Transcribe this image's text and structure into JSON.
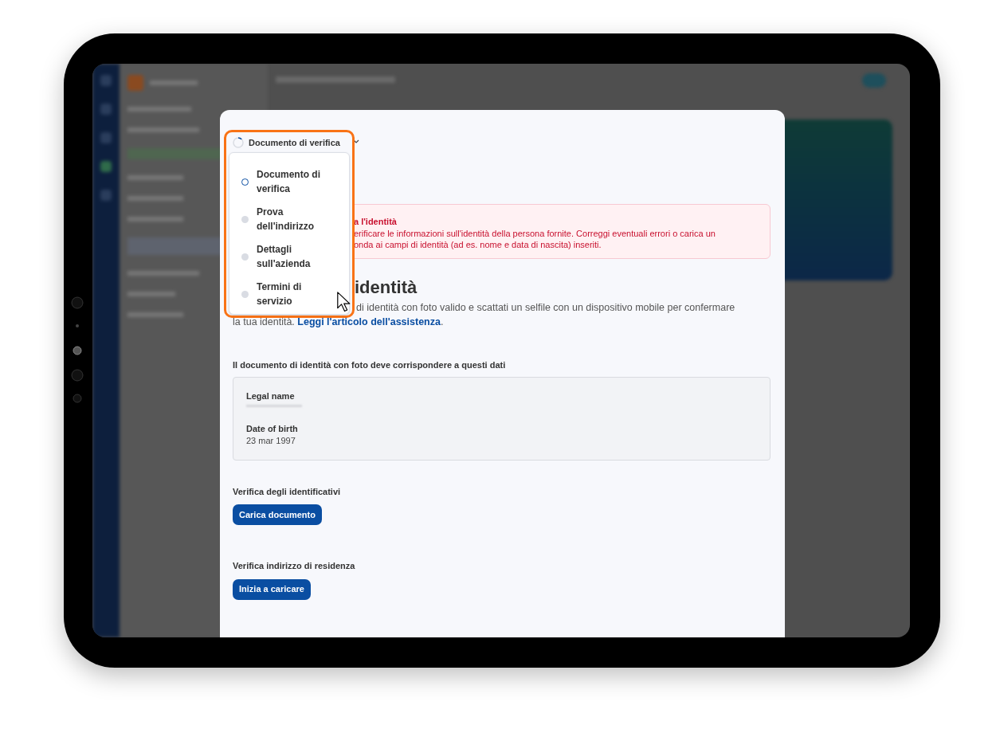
{
  "stepper": {
    "current": "Documento di verifica",
    "steps": [
      {
        "label": "Documento di verifica",
        "selected": true
      },
      {
        "label": "Prova dell'indirizzo",
        "selected": false
      },
      {
        "label": "Dettagli sull'azienda",
        "selected": false
      },
      {
        "label": "Termini di servizio",
        "selected": false
      }
    ]
  },
  "alert": {
    "title": "a l'identità",
    "lines": [
      "erificare le informazioni sull'identità della persona fornite. Correggi eventuali errori o carica un",
      "onda ai campi di identità (ad es. nome e data di nascita) inseriti."
    ]
  },
  "heading": "identità",
  "description": {
    "line_1": "di identità con foto valido e scattati un selfile con un dispositivo mobile per confermare",
    "line_2": "la tua identità.",
    "link": "Leggi l'articolo dell'assistenza",
    "line_2_end": "."
  },
  "identity_data": {
    "title": "Il documento di identità con foto deve corrispondere a questi dati",
    "fields": [
      {
        "label": "Legal name",
        "redacted": true
      },
      {
        "label": "Date of birth",
        "value": "23 mar 1997",
        "redacted": false
      }
    ]
  },
  "sections": [
    {
      "title": "Verifica degli identificativi",
      "button": "Carica documento"
    },
    {
      "title": "Verifica indirizzo di residenza",
      "button": "Inizia a caricare"
    }
  ]
}
